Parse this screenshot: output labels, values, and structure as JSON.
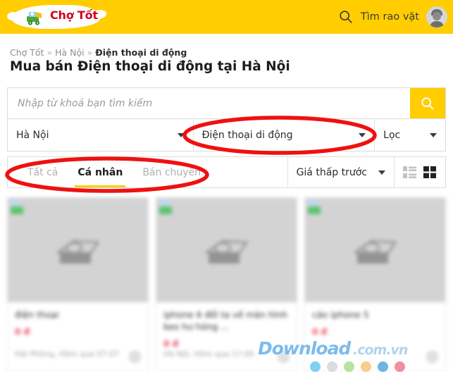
{
  "header": {
    "logo_text": "Chợ Tốt",
    "logo_icon": "market-cart-icon",
    "search_icon": "search-icon",
    "search_label": "Tìm rao vặt",
    "avatar_icon": "user-avatar-icon",
    "bg_color": "#ffcd00"
  },
  "breadcrumb": {
    "items": [
      {
        "label": "Chợ Tốt",
        "current": false
      },
      {
        "label": "Hà Nội",
        "current": false
      },
      {
        "label": "Điện thoại di động",
        "current": true
      }
    ],
    "separator": "»"
  },
  "page_title": "Mua bán Điện thoại di động tại Hà Nội",
  "search": {
    "placeholder": "Nhập từ khoá bạn tìm kiếm",
    "value": "",
    "button_icon": "search-icon",
    "button_color": "#ffcd00"
  },
  "filters": {
    "location": {
      "label": "Hà Nội",
      "icon": "chevron-down-icon"
    },
    "category": {
      "label": "Điện thoại di động",
      "icon": "chevron-down-icon"
    },
    "more": {
      "label": "Lọc",
      "icon": "chevron-down-icon"
    }
  },
  "tabs": [
    {
      "label": "Tất cả",
      "active": false
    },
    {
      "label": "Cá nhân",
      "active": true
    },
    {
      "label": "Bán chuyên",
      "active": false
    }
  ],
  "sort": {
    "label": "Giá thấp trước",
    "icon": "chevron-down-icon"
  },
  "view_modes": [
    {
      "name": "list-view-icon",
      "active": false
    },
    {
      "name": "grid-view-icon",
      "active": true
    }
  ],
  "listings": [
    {
      "title": "điện thoại",
      "price": "0 đ",
      "meta": "Hải Phòng, Hôm qua 07:07",
      "badge": "verified-badge",
      "placeholder_icon": "image-placeholder-icon",
      "avatar": "seller-avatar-icon"
    },
    {
      "title": "iphone 6 đổi ta về màn hình keo hư hỏng ...",
      "price": "0 đ",
      "meta": "Hà Nội, Hôm qua 17:00",
      "badge": "verified-badge",
      "placeholder_icon": "image-placeholder-icon",
      "avatar": "seller-avatar-icon"
    },
    {
      "title": "cáo iphone 5",
      "price": "0 đ",
      "meta": "",
      "badge": "verified-badge",
      "placeholder_icon": "image-placeholder-icon",
      "avatar": "seller-avatar-icon"
    }
  ],
  "annotations": {
    "color": "#ee1111",
    "shapes": [
      {
        "name": "category-filter-highlight",
        "target": "Điện thoại di động"
      },
      {
        "name": "tabs-highlight",
        "target": "Tất cả / Cá nhân / Bán chuyên"
      }
    ]
  },
  "watermark": {
    "primary": "Download",
    "secondary": ".com.vn",
    "dot_colors": [
      "#7fd2ef",
      "#dcdcdc",
      "#b8e2a0",
      "#f6cf8e",
      "#6fb6e0",
      "#f0909e"
    ]
  }
}
